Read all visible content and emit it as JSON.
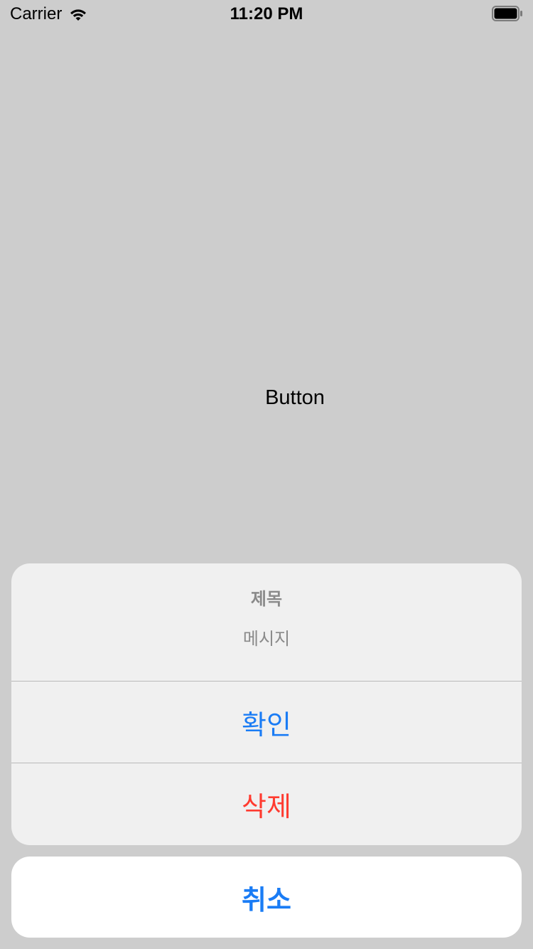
{
  "status_bar": {
    "carrier": "Carrier",
    "time": "11:20 PM",
    "wifi_icon": "wifi-icon",
    "battery_icon": "battery-icon"
  },
  "main": {
    "button_label": "Button"
  },
  "action_sheet": {
    "title": "제목",
    "message": "메시지",
    "actions": [
      {
        "label": "확인",
        "style": "default",
        "color": "#1a7cf5"
      },
      {
        "label": "삭제",
        "style": "destructive",
        "color": "#ff3b30"
      }
    ],
    "cancel_label": "취소"
  },
  "colors": {
    "background": "#cdcdcd",
    "sheet_background": "#f0f0f0",
    "accent": "#1a7cf5",
    "destructive": "#ff3b30",
    "secondary_text": "#8a8a8a"
  }
}
